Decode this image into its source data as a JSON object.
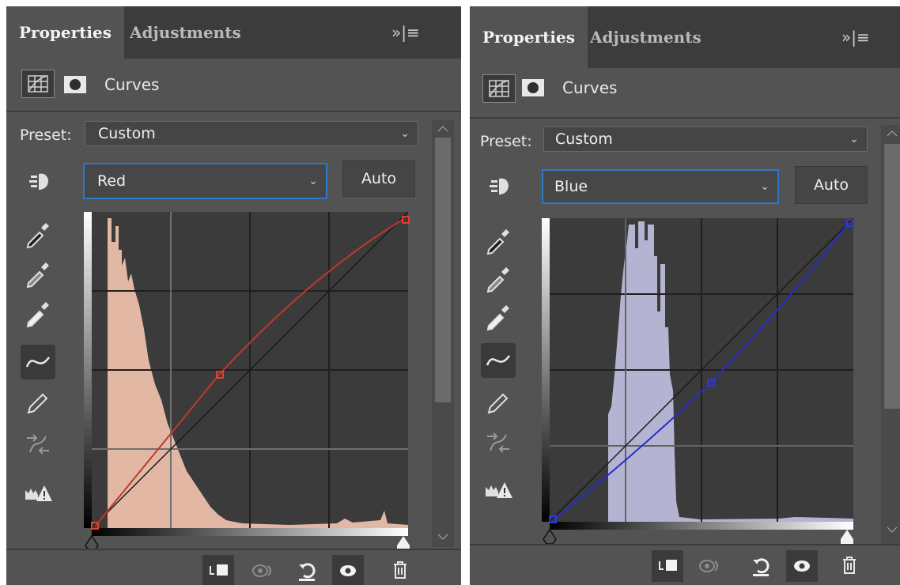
{
  "panels": [
    {
      "tabs": {
        "properties": "Properties",
        "adjustments": "Adjustments"
      },
      "tab_menu_glyph": "»|≡",
      "adjustment_title": "Curves",
      "preset_label": "Preset:",
      "preset_value": "Custom",
      "channel_value": "Red",
      "auto_label": "Auto",
      "curve_color": "#c0392b",
      "histogram_color": "#e2b8a5",
      "curve_points_0_255": [
        [
          0,
          0
        ],
        [
          128,
          150
        ],
        [
          255,
          255
        ]
      ],
      "histogram_peak_range": "low tones"
    },
    {
      "tabs": {
        "properties": "Properties",
        "adjustments": "Adjustments"
      },
      "tab_menu_glyph": "»|≡",
      "adjustment_title": "Curves",
      "preset_label": "Preset:",
      "preset_value": "Custom",
      "channel_value": "Blue",
      "auto_label": "Auto",
      "curve_color": "#2430c8",
      "histogram_color": "#b4b4d2",
      "curve_points_0_255": [
        [
          0,
          0
        ],
        [
          128,
          115
        ],
        [
          255,
          255
        ]
      ],
      "histogram_peak_range": "low-mid tones"
    }
  ],
  "tool_icons": [
    "sample-black-eyedropper-icon",
    "sample-gray-eyedropper-icon",
    "sample-white-eyedropper-icon",
    "curve-points-icon",
    "pencil-icon",
    "smooth-icon",
    "clipping-warning-icon"
  ],
  "bottom_icons": [
    "clip-to-layer-icon",
    "view-previous-icon",
    "reset-icon",
    "visibility-eye-icon",
    "delete-trash-icon"
  ]
}
